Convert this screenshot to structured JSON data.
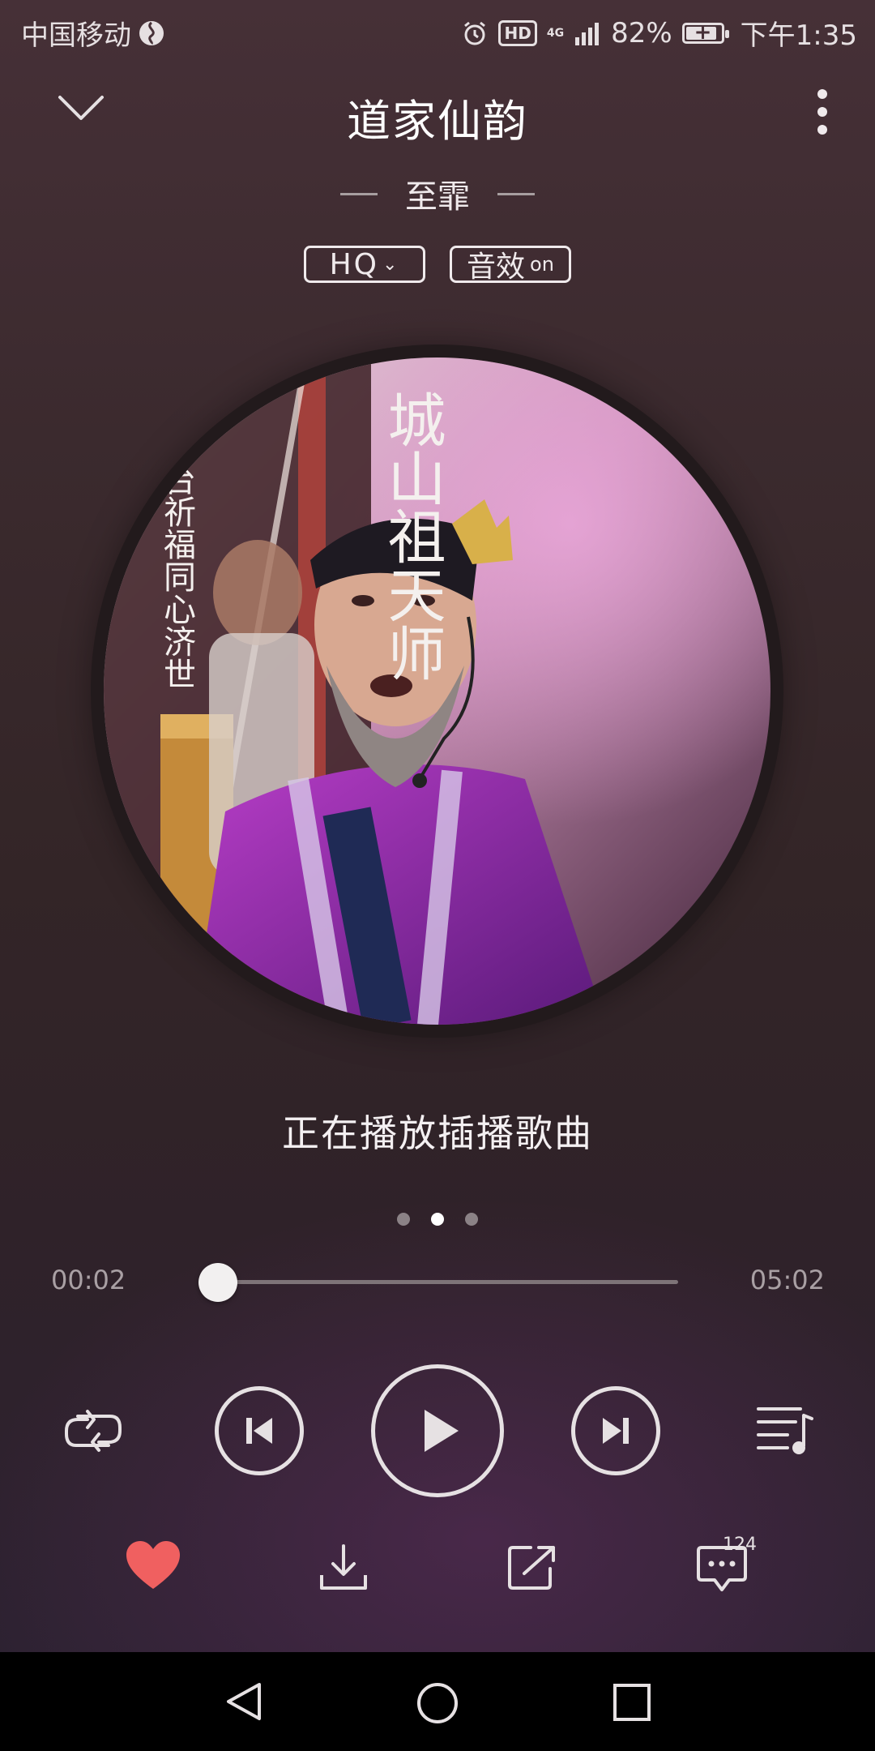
{
  "status_bar": {
    "carrier": "中国移动",
    "hd": "HD",
    "network": "4G",
    "battery": "82%",
    "time": "下午1:35"
  },
  "header": {
    "title": "道家仙韵",
    "artist": "至霏"
  },
  "badges": {
    "quality": "HQ",
    "effects": "音效",
    "effects_state": "on"
  },
  "cover": {
    "calligraphy_main": "城山祖天师",
    "calligraphy_side": "巡台祈福同心济世"
  },
  "now_playing_text": "正在播放插播歌曲",
  "pager": {
    "count": 3,
    "active": 1
  },
  "progress": {
    "current": "00:02",
    "duration": "05:02",
    "fraction": 0.007
  },
  "controls": {
    "repeat": "repeat-icon",
    "prev": "skip-previous-icon",
    "play": "play-icon",
    "next": "skip-next-icon",
    "playlist": "playlist-icon"
  },
  "actions": {
    "favorite_color": "#f06060",
    "comment_count": "124"
  },
  "colors": {
    "accent": "#3fcf8e",
    "heart": "#f06060"
  }
}
